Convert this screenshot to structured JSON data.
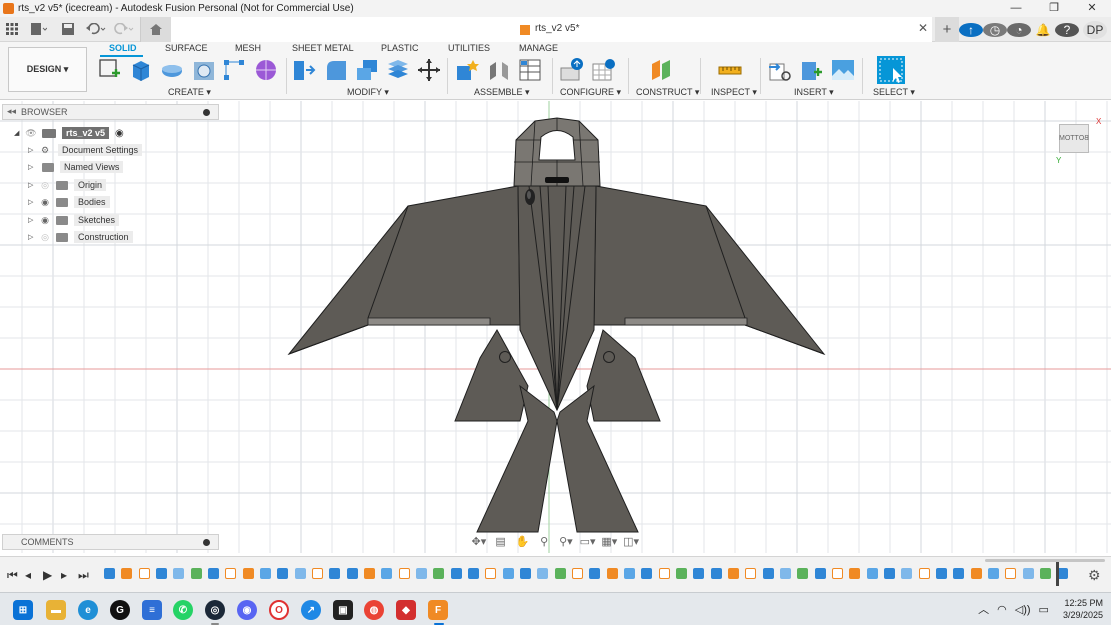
{
  "window": {
    "title": "rts_v2 v5* (icecream) - Autodesk Fusion Personal (Not for Commercial Use)",
    "minimize": "—",
    "maximize": "❐",
    "close": "✕"
  },
  "quick_access": {
    "grid_icon": "grid-icon",
    "file_icon": "file-icon",
    "save_icon": "save-icon",
    "undo_icon": "undo-icon",
    "redo_icon": "redo-icon"
  },
  "document_tab": {
    "title": "rts_v2 v5*",
    "close": "✕"
  },
  "right_actions": {
    "avatar_initials": "DP"
  },
  "ribbon": {
    "workspace_button": "DESIGN ▾",
    "tabs": [
      "SOLID",
      "SURFACE",
      "MESH",
      "SHEET METAL",
      "PLASTIC",
      "UTILITIES",
      "MANAGE"
    ],
    "active_tab": "SOLID",
    "groups": [
      "CREATE ▾",
      "MODIFY ▾",
      "ASSEMBLE ▾",
      "CONFIGURE ▾",
      "CONSTRUCT ▾",
      "INSPECT ▾",
      "INSERT ▾",
      "SELECT ▾"
    ],
    "accent": "#0696d7"
  },
  "browser": {
    "header": "BROWSER",
    "root": "rts_v2 v5",
    "items": [
      {
        "label": "Document Settings",
        "icon": "gear-icon"
      },
      {
        "label": "Named Views",
        "icon": "folder-icon"
      },
      {
        "label": "Origin",
        "icon": "folder-icon"
      },
      {
        "label": "Bodies",
        "icon": "folder-icon"
      },
      {
        "label": "Sketches",
        "icon": "folder-icon"
      },
      {
        "label": "Construction",
        "icon": "folder-icon"
      }
    ]
  },
  "comments": {
    "header": "COMMENTS"
  },
  "viewcube": {
    "face": "BOTTOM",
    "x_axis": "X",
    "y_axis": "Y"
  },
  "model": {
    "body_color": "#5e5b56",
    "edge_color": "#1f1f1f",
    "grid_color": "#e3e6ea",
    "axis_x_color": "#e79a9a",
    "axis_y_color": "#9fd19f"
  },
  "taskbar": {
    "time": "12:25 PM",
    "date": "3/29/2025"
  }
}
